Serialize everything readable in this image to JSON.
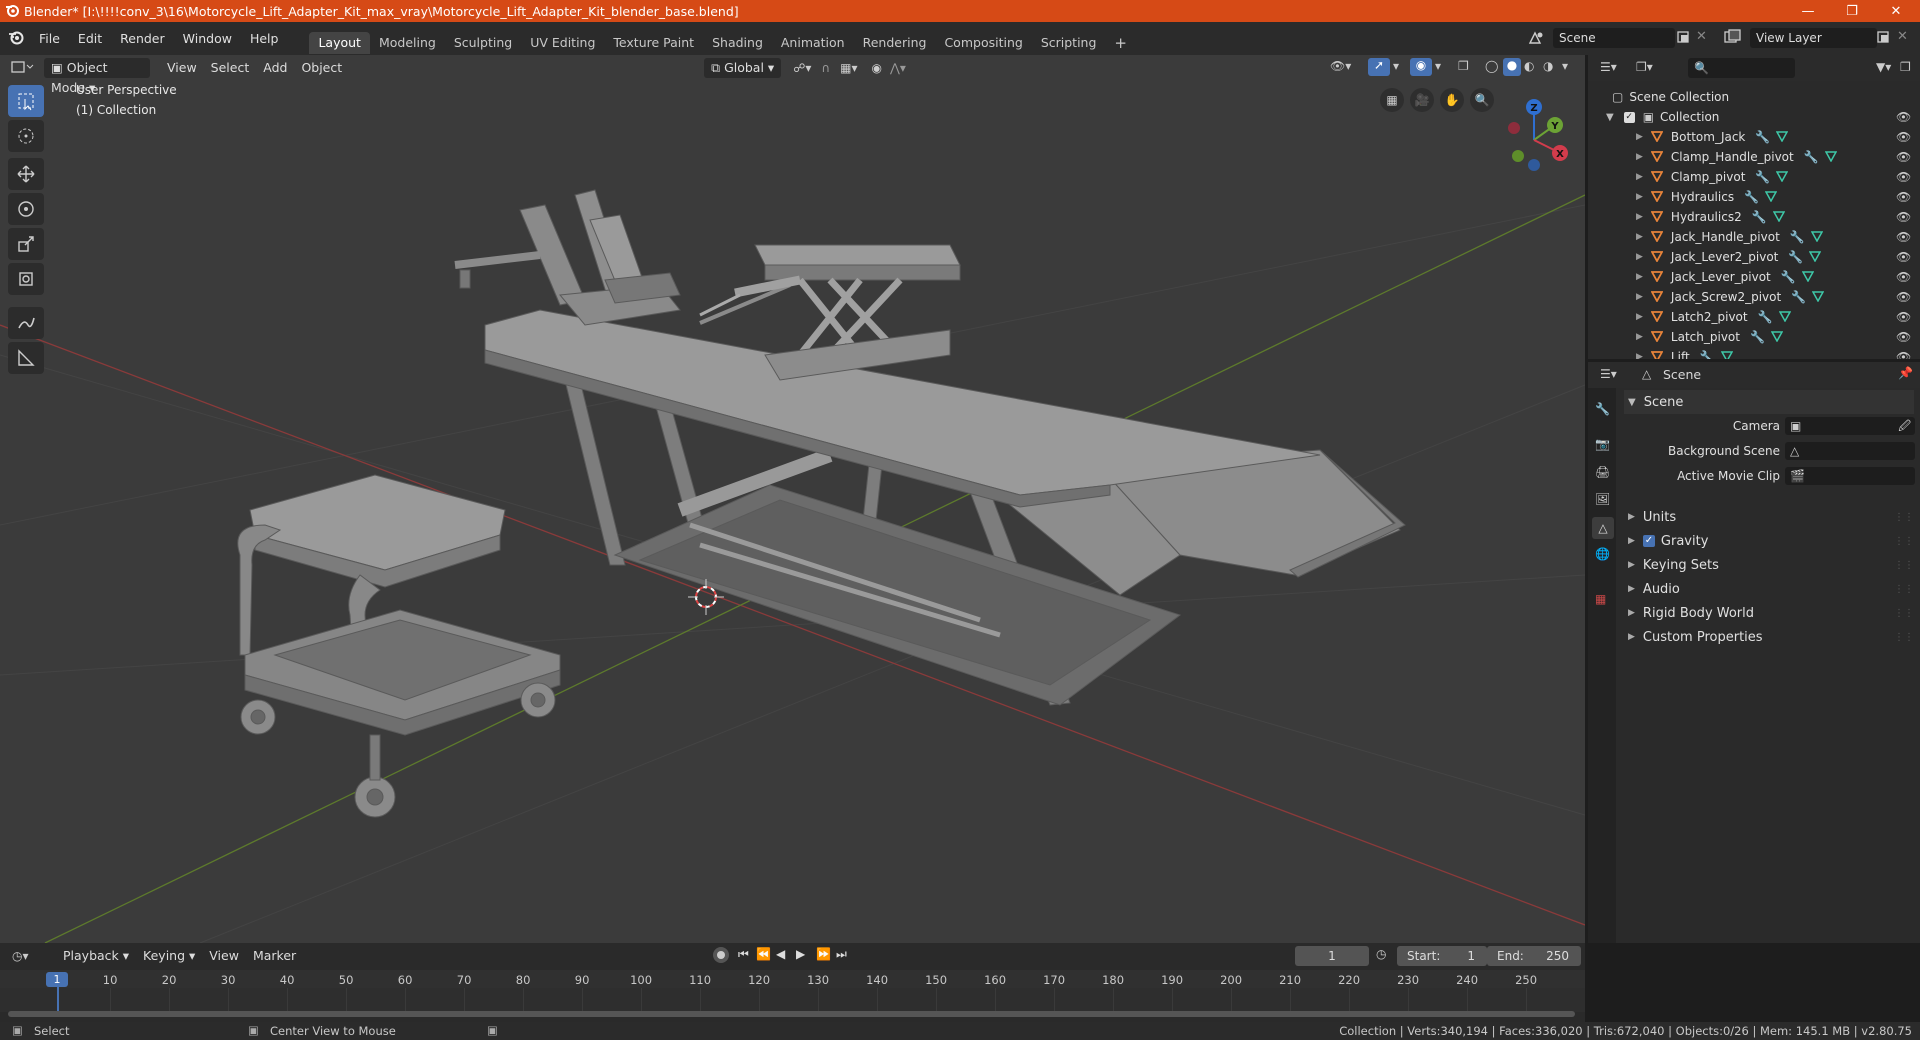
{
  "window": {
    "title": "Blender* [I:\\!!!!conv_3\\16\\Motorcycle_Lift_Adapter_Kit_max_vray\\Motorcycle_Lift_Adapter_Kit_blender_base.blend]",
    "accent": "#d64a16"
  },
  "menu": [
    "File",
    "Edit",
    "Render",
    "Window",
    "Help"
  ],
  "workspaces": [
    "Layout",
    "Modeling",
    "Sculpting",
    "UV Editing",
    "Texture Paint",
    "Shading",
    "Animation",
    "Rendering",
    "Compositing",
    "Scripting"
  ],
  "active_workspace": "Layout",
  "scene_selector": "Scene",
  "view_layer_selector": "View Layer",
  "viewport": {
    "mode": "Object Mode",
    "menus": [
      "View",
      "Select",
      "Add",
      "Object"
    ],
    "transform_orientation": "Global",
    "overlay_text_1": "User Perspective",
    "overlay_text_2": "(1) Collection",
    "gizmo_labels": {
      "z": "Z",
      "y": "Y",
      "x": "X"
    }
  },
  "outliner": {
    "root": "Scene Collection",
    "collection": "Collection",
    "items": [
      "Bottom_Jack",
      "Clamp_Handle_pivot",
      "Clamp_pivot",
      "Hydraulics",
      "Hydraulics2",
      "Jack_Handle_pivot",
      "Jack_Lever2_pivot",
      "Jack_Lever_pivot",
      "Jack_Screw2_pivot",
      "Latch2_pivot",
      "Latch_pivot",
      "Lift"
    ]
  },
  "properties": {
    "context": "Scene",
    "panel": "Scene",
    "fields": [
      {
        "label": "Camera"
      },
      {
        "label": "Background Scene"
      },
      {
        "label": "Active Movie Clip"
      }
    ],
    "sections": [
      "Units",
      "Gravity",
      "Keying Sets",
      "Audio",
      "Rigid Body World",
      "Custom Properties"
    ]
  },
  "timeline": {
    "menus": [
      "Playback",
      "Keying",
      "View",
      "Marker"
    ],
    "current_frame": "1",
    "start_label": "Start:",
    "start": "1",
    "end_label": "End:",
    "end": "250",
    "ticks": [
      "10",
      "20",
      "30",
      "40",
      "50",
      "60",
      "70",
      "80",
      "90",
      "100",
      "110",
      "120",
      "130",
      "140",
      "150",
      "160",
      "170",
      "180",
      "190",
      "200",
      "210",
      "220",
      "230",
      "240",
      "250"
    ],
    "cursor_label": "1"
  },
  "status": {
    "left": "Select",
    "middle": "Center View to Mouse",
    "right": "Collection | Verts:340,194 | Faces:336,020 | Tris:672,040 | Objects:0/26 | Mem: 145.1 MB | v2.80.75"
  }
}
